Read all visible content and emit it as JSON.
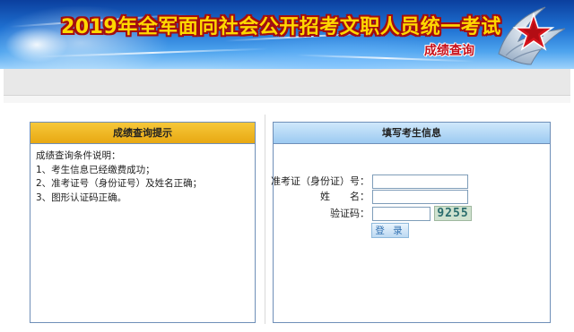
{
  "banner": {
    "title": "2019年全军面向社会公开招考文职人员统一考试",
    "subtitle": "成绩查询"
  },
  "notice_panel": {
    "heading": "成绩查询提示",
    "lines": [
      "成绩查询条件说明：",
      "1、考生信息已经缴费成功；",
      "2、准考证号（身份证号）及姓名正确；",
      "3、图形认证码正确。"
    ]
  },
  "form_panel": {
    "heading": "填写考生信息",
    "id_label": "准考证（身份证）号：",
    "id_value": "",
    "name_label": "姓　　名：",
    "name_value": "",
    "captcha_label": "验证码：",
    "captcha_value": "",
    "captcha_code": "9255",
    "login_label": "登 录"
  },
  "colors": {
    "banner_title": "#ffd800",
    "banner_subtitle": "#c8101a",
    "notice_header": "#f0b824",
    "form_header": "#9ccaf1"
  }
}
